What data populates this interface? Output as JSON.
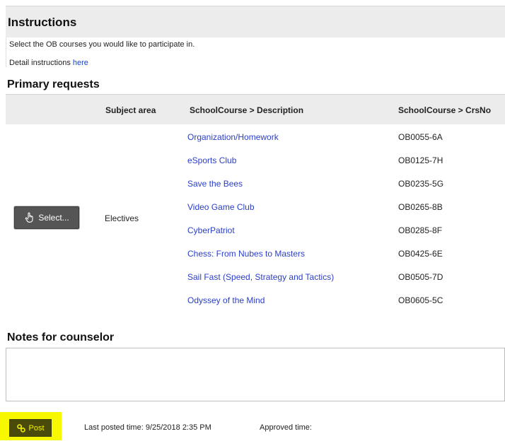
{
  "instructions": {
    "title": "Instructions",
    "line1": "Select the OB courses you would like to participate in.",
    "line2_prefix": "Detail instructions ",
    "line2_link": "here"
  },
  "primary": {
    "title": "Primary requests",
    "headers": {
      "subject": "Subject area",
      "description": "SchoolCourse > Description",
      "crsno": "SchoolCourse > CrsNo"
    },
    "select_label": "Select...",
    "subject": "Electives",
    "courses": [
      {
        "description": "Organization/Homework",
        "crsno": "OB0055-6A"
      },
      {
        "description": "eSports Club",
        "crsno": "OB0125-7H"
      },
      {
        "description": "Save the Bees",
        "crsno": "OB0235-5G"
      },
      {
        "description": "Video Game Club",
        "crsno": "OB0265-8B"
      },
      {
        "description": "CyberPatriot",
        "crsno": "OB0285-8F"
      },
      {
        "description": "Chess: From Nubes to Masters",
        "crsno": "OB0425-6E"
      },
      {
        "description": "Sail Fast (Speed, Strategy and Tactics)",
        "crsno": "OB0505-7D"
      },
      {
        "description": "Odyssey of the Mind",
        "crsno": "OB0605-5C"
      }
    ]
  },
  "notes": {
    "title": "Notes for counselor",
    "value": ""
  },
  "footer": {
    "post_label": "Post",
    "last_posted": "Last posted time: 9/25/2018 2:35 PM",
    "approved": "Approved time:"
  },
  "icons": {
    "select": "hand-pointer-icon",
    "post": "link-icon"
  },
  "colors": {
    "link": "#2a3ec8",
    "header_bg": "#ececec",
    "highlight": "#f7f700",
    "post_btn_bg": "#4a4a0a",
    "select_btn_bg": "#555555"
  }
}
